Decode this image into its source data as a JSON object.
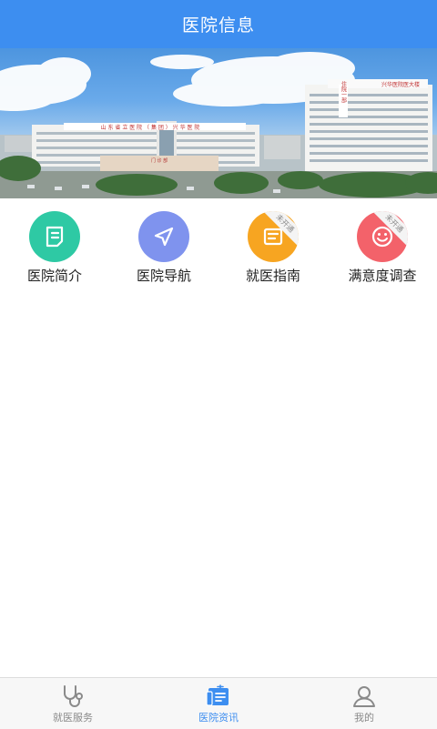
{
  "header": {
    "title": "医院信息"
  },
  "banner": {
    "main_building_sign": "山 东 省 立 医 院 （ 集 团 ） 兴 华 医 院",
    "right_building_sign": "兴华医院医大楼",
    "tower_sign": "住院一部",
    "podium_sign": "门 诊 部"
  },
  "grid": {
    "items": [
      {
        "label": "医院简介",
        "icon": "document-icon",
        "color": "#2ec9a4",
        "badge": ""
      },
      {
        "label": "医院导航",
        "icon": "navigation-arrow-icon",
        "color": "#7f93ee",
        "badge": ""
      },
      {
        "label": "就医指南",
        "icon": "guide-card-icon",
        "color": "#f7a521",
        "badge": "未开通"
      },
      {
        "label": "满意度调查",
        "icon": "smiley-icon",
        "color": "#f3626a",
        "badge": "未开通"
      }
    ]
  },
  "tabbar": {
    "tabs": [
      {
        "label": "就医服务",
        "icon": "stethoscope-icon"
      },
      {
        "label": "医院资讯",
        "icon": "news-icon"
      },
      {
        "label": "我的",
        "icon": "user-icon"
      }
    ],
    "active_index": 1,
    "active_color": "#3d8ef0",
    "inactive_color": "#8a8a8a"
  }
}
